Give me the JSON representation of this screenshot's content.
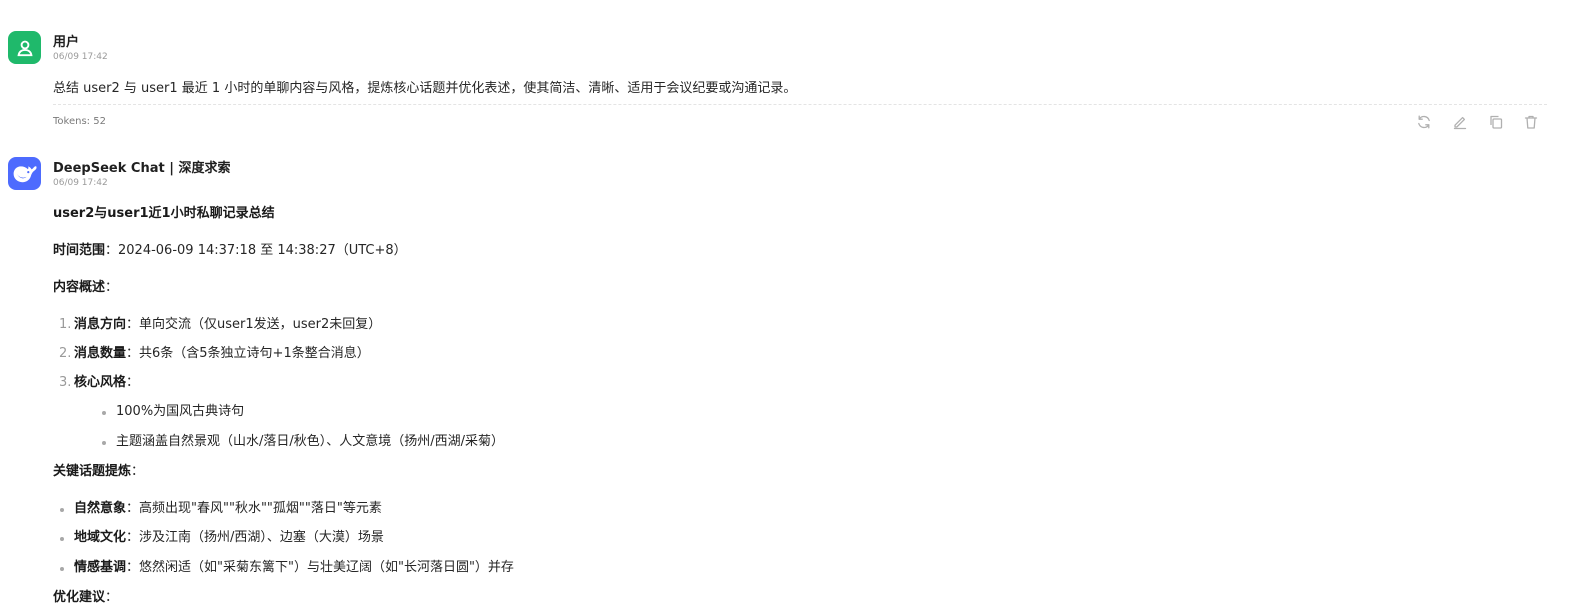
{
  "user_message": {
    "author": "用户",
    "time": "06/09 17:42",
    "text": "总结 user2 与 user1 最近 1 小时的单聊内容与风格，提炼核心话题并优化表述，使其简洁、清晰、适用于会议纪要或沟通记录。",
    "tokens": "Tokens: 52",
    "actions": [
      "refresh-icon",
      "edit-icon",
      "copy-icon",
      "delete-icon"
    ]
  },
  "bot_message": {
    "author": "DeepSeek Chat | 深度求索",
    "time": "06/09 17:42",
    "title": "user2与user1近1小时私聊记录总结",
    "time_range_label": "时间范围",
    "time_range_value": "：2024-06-09 14:37:18 至 14:38:27（UTC+8）",
    "overview_heading": "内容概述",
    "overview_items": [
      {
        "num": "1.",
        "label": "消息方向",
        "text": "：单向交流（仅user1发送，user2未回复）"
      },
      {
        "num": "2.",
        "label": "消息数量",
        "text": "：共6条（含5条独立诗句+1条整合消息）"
      },
      {
        "num": "3.",
        "label": "核心风格",
        "text": "："
      }
    ],
    "style_points": [
      "100%为国风古典诗句",
      "主题涵盖自然景观（山水/落日/秋色）、人文意境（扬州/西湖/采菊）"
    ],
    "topics_heading": "关键话题提炼",
    "topics": [
      {
        "label": "自然意象",
        "text": "：高频出现\"春风\"\"秋水\"\"孤烟\"\"落日\"等元素"
      },
      {
        "label": "地域文化",
        "text": "：涉及江南（扬州/西湖）、边塞（大漠）场景"
      },
      {
        "label": "情感基调",
        "text": "：悠然闲适（如\"采菊东篱下\"）与壮美辽阔（如\"长河落日圆\"）并存"
      }
    ],
    "suggestions_heading": "优化建议"
  },
  "colors": {
    "user_avatar": "#1fb96b",
    "bot_avatar": "#4d6bfe",
    "timestamp": "#9a9a9a",
    "icon": "#b0b0b0"
  }
}
